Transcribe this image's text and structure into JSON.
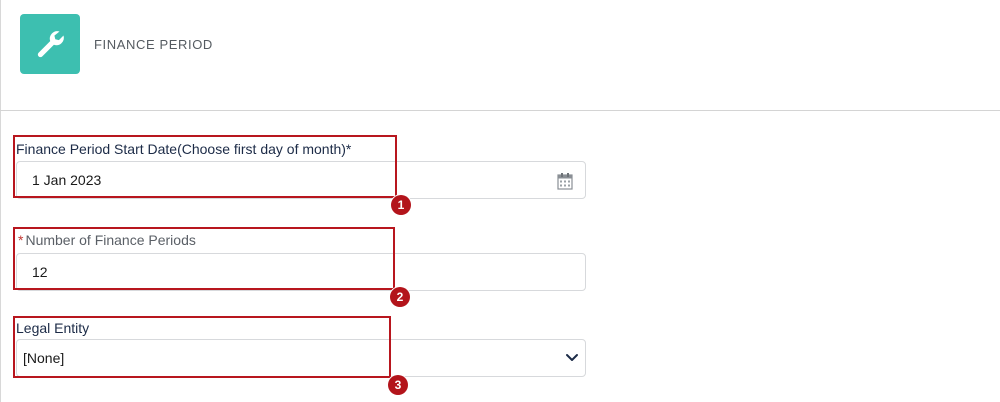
{
  "header": {
    "title": "FINANCE PERIOD",
    "icon": "wrench-icon"
  },
  "fields": [
    {
      "label": "Finance Period Start Date(Choose first day of month)*",
      "value": "1 Jan 2023",
      "icon": "calendar-icon",
      "marker": "1"
    },
    {
      "required_mark": "*",
      "label": "Number of Finance Periods",
      "value": "12",
      "marker": "2"
    },
    {
      "label": "Legal Entity",
      "value": "[None]",
      "icon": "chevron-down-icon",
      "marker": "3"
    }
  ],
  "colors": {
    "accent": "#3dbfb0",
    "highlight": "#b8161e",
    "required": "#c23934"
  }
}
